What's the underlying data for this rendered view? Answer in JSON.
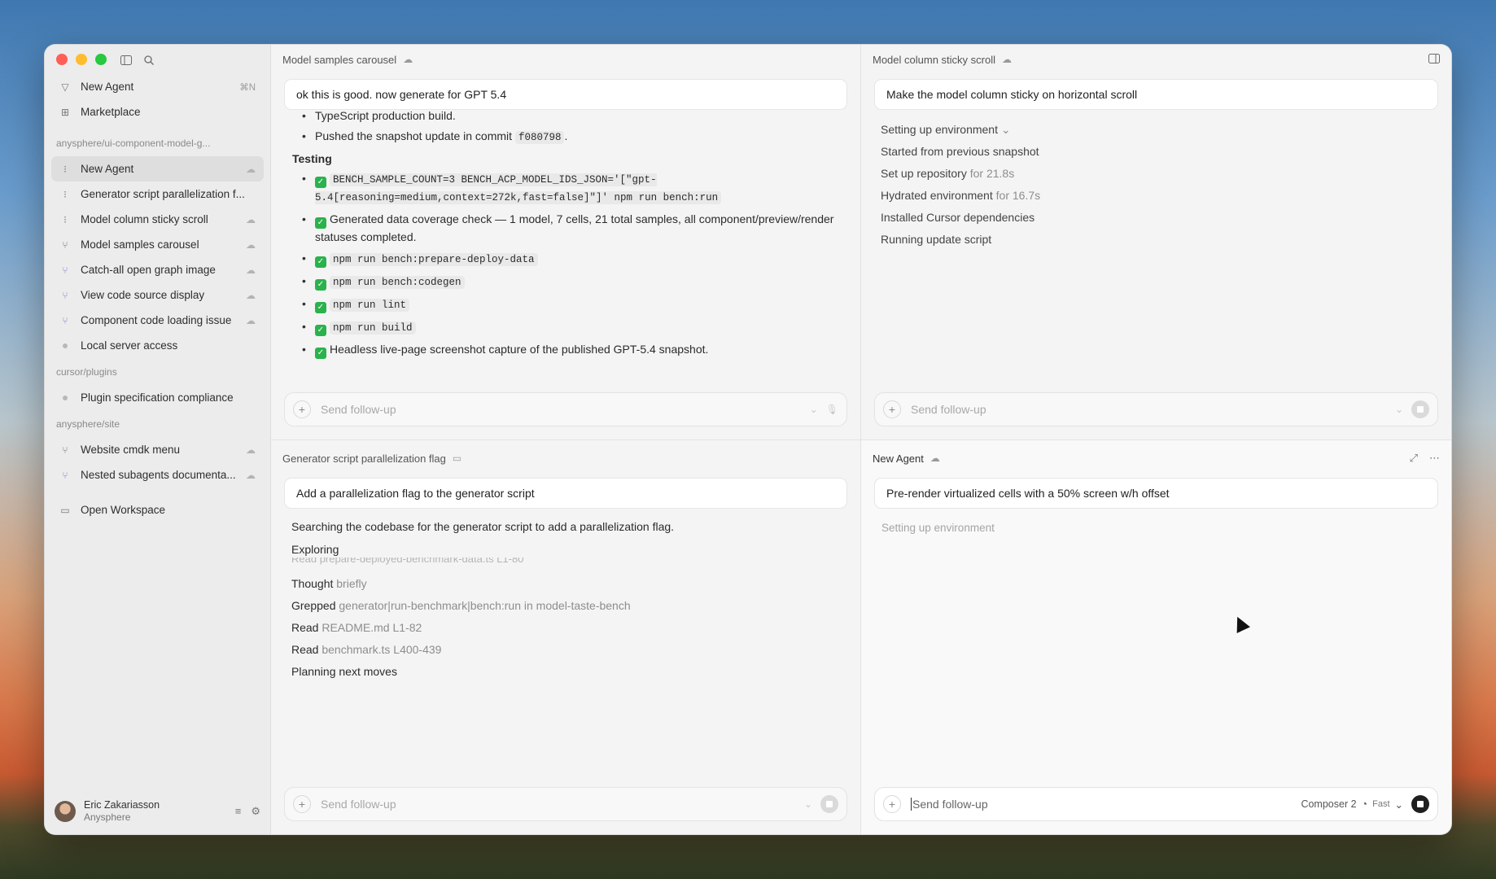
{
  "sidebar": {
    "nav": [
      {
        "label": "New Agent",
        "shortcut": "⌘N",
        "icon": "agent-icon"
      },
      {
        "label": "Marketplace",
        "icon": "marketplace-icon"
      }
    ],
    "groups": [
      {
        "label": "anysphere/ui-component-model-g...",
        "items": [
          {
            "label": "New Agent",
            "active": true,
            "icon": "loading-icon",
            "cloud": true
          },
          {
            "label": "Generator script parallelization f...",
            "icon": "loading-icon"
          },
          {
            "label": "Model column sticky scroll",
            "icon": "loading-icon",
            "cloud": true
          },
          {
            "label": "Model samples carousel",
            "icon": "branch-icon",
            "cloud": true
          },
          {
            "label": "Catch-all open graph image",
            "icon": "branch-icon",
            "cloud": true
          },
          {
            "label": "View code source display",
            "icon": "branch-icon",
            "cloud": true
          },
          {
            "label": "Component code loading issue",
            "icon": "branch-icon",
            "cloud": true
          },
          {
            "label": "Local server access",
            "icon": "dot-icon"
          }
        ]
      },
      {
        "label": "cursor/plugins",
        "items": [
          {
            "label": "Plugin specification compliance",
            "icon": "dot-icon"
          }
        ]
      },
      {
        "label": "anysphere/site",
        "items": [
          {
            "label": "Website cmdk menu",
            "icon": "branch-icon",
            "cloud": true
          },
          {
            "label": "Nested subagents documenta...",
            "icon": "branch-icon",
            "cloud": true
          }
        ]
      }
    ],
    "open_workspace": "Open Workspace",
    "user": {
      "name": "Eric Zakariasson",
      "org": "Anysphere"
    }
  },
  "panes": {
    "top_left": {
      "title": "Model samples carousel",
      "prompt": "ok this is good. now generate for GPT 5.4",
      "partial_line": "TypeScript production build.",
      "pushed_prefix": "Pushed the snapshot update in commit",
      "pushed_commit": "f080798",
      "pushed_suffix": ".",
      "testing_heading": "Testing",
      "testing_items": [
        {
          "code": "BENCH_SAMPLE_COUNT=3 BENCH_ACP_MODEL_IDS_JSON='[\"gpt-5.4[reasoning=medium,context=272k,fast=false]\"]' npm run bench:run"
        },
        {
          "text": "Generated data coverage check — 1 model, 7 cells, 21 total samples, all component/preview/render statuses completed."
        },
        {
          "code": "npm run bench:prepare-deploy-data"
        },
        {
          "code": "npm run bench:codegen"
        },
        {
          "code": "npm run lint"
        },
        {
          "code": "npm run build"
        },
        {
          "text": "Headless live-page screenshot capture of the published GPT-5.4 snapshot."
        }
      ],
      "followup_placeholder": "Send follow-up"
    },
    "top_right": {
      "title": "Model column sticky scroll",
      "prompt": "Make the model column sticky on horizontal scroll",
      "status": [
        {
          "text": "Setting up environment",
          "chevron": true
        },
        {
          "text": "Started from previous snapshot"
        },
        {
          "text": "Set up repository",
          "muted": "for 21.8s"
        },
        {
          "text": "Hydrated environment",
          "muted": "for 16.7s"
        },
        {
          "text": "Installed Cursor dependencies"
        },
        {
          "text": "Running update script"
        }
      ],
      "followup_placeholder": "Send follow-up"
    },
    "bottom_left": {
      "title": "Generator script parallelization flag",
      "prompt": "Add a parallelization flag to the generator script",
      "intro": "Searching the codebase for the generator script to add a parallelization flag.",
      "exploring": "Exploring",
      "faded_line": "Read prepare-deployed-benchmark-data.ts L1-80",
      "steps": [
        {
          "verb": "Thought",
          "detail": "briefly"
        },
        {
          "verb": "Grepped",
          "detail": "generator|run-benchmark|bench:run in model-taste-bench"
        },
        {
          "verb": "Read",
          "detail": "README.md L1-82"
        },
        {
          "verb": "Read",
          "detail": "benchmark.ts L400-439"
        },
        {
          "verb": "Planning next moves",
          "detail": ""
        }
      ],
      "followup_placeholder": "Send follow-up"
    },
    "bottom_right": {
      "title": "New Agent",
      "prompt": "Pre-render virtualized cells with a 50% screen w/h offset",
      "status": "Setting up environment",
      "followup_placeholder": "Send follow-up",
      "model": "Composer 2",
      "speed": "Fast"
    }
  }
}
